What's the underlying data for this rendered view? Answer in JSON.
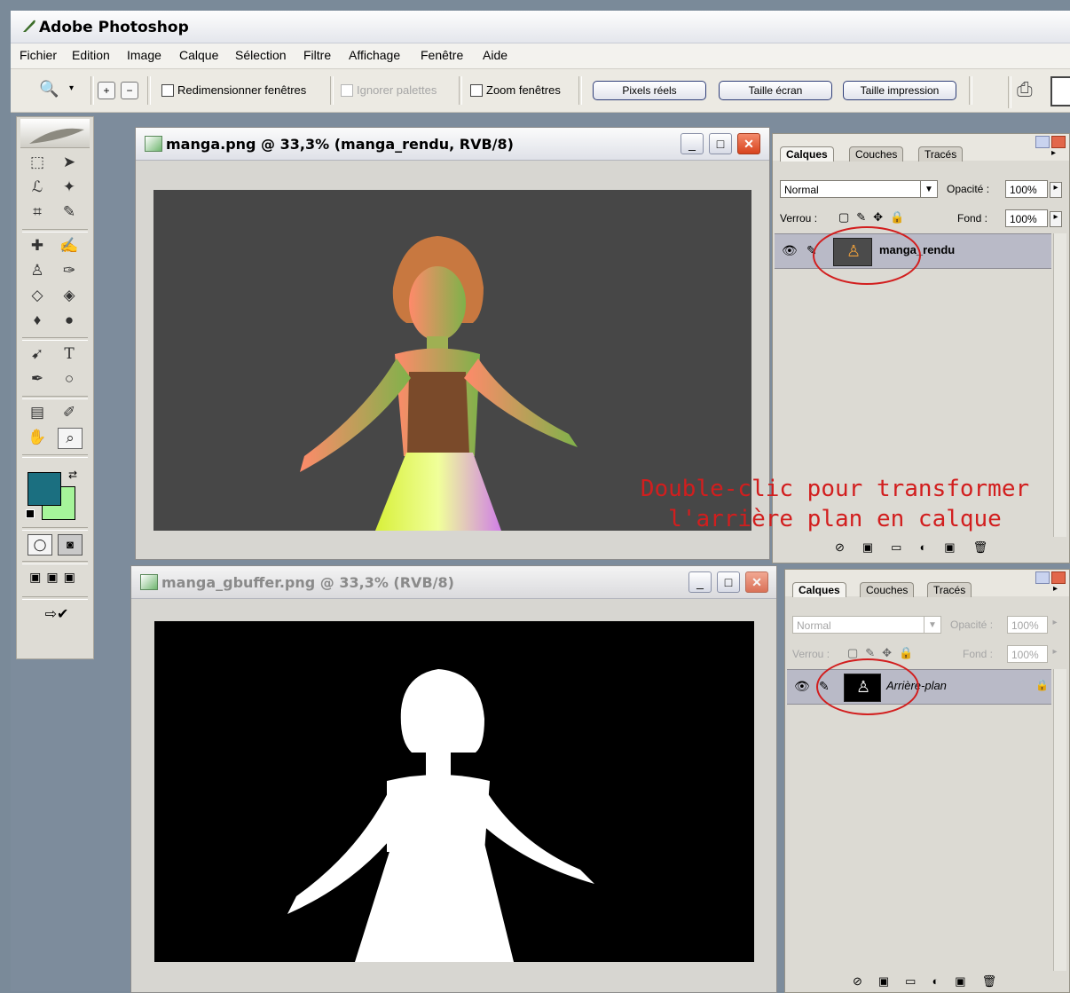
{
  "app": {
    "title": "Adobe Photoshop"
  },
  "menubar": {
    "items": [
      "Fichier",
      "Edition",
      "Image",
      "Calque",
      "Sélection",
      "Filtre",
      "Affichage",
      "Fenêtre",
      "Aide"
    ]
  },
  "options_bar": {
    "resize_windows_label": "Redimensionner fenêtres",
    "ignore_palettes_label": "Ignorer palettes",
    "zoom_windows_label": "Zoom fenêtres",
    "actual_pixels_label": "Pixels réels",
    "fit_screen_label": "Taille écran",
    "print_size_label": "Taille impression"
  },
  "doc1": {
    "title": "manga.png @ 33,3% (manga_rendu, RVB/8)"
  },
  "doc2": {
    "title": "manga_gbuffer.png @ 33,3% (RVB/8)"
  },
  "panel1": {
    "tabs": [
      "Calques",
      "Couches",
      "Tracés"
    ],
    "blend_mode": "Normal",
    "opacity_label": "Opacité :",
    "opacity_value": "100%",
    "lock_label": "Verrou :",
    "fill_label": "Fond :",
    "fill_value": "100%",
    "layer_name": "manga_rendu"
  },
  "panel2": {
    "tabs": [
      "Calques",
      "Couches",
      "Tracés"
    ],
    "blend_mode": "Normal",
    "opacity_label": "Opacité :",
    "opacity_value": "100%",
    "lock_label": "Verrou :",
    "fill_label": "Fond :",
    "fill_value": "100%",
    "layer_name": "Arrière-plan"
  },
  "annotation": {
    "line1": "Double-clic pour transformer",
    "line2": "l'arrière plan en calque",
    "color": "#d21e1e"
  },
  "colors": {
    "foreground": "#1b6f80",
    "background": "#a6f59a",
    "accent": "#2f3e78"
  }
}
